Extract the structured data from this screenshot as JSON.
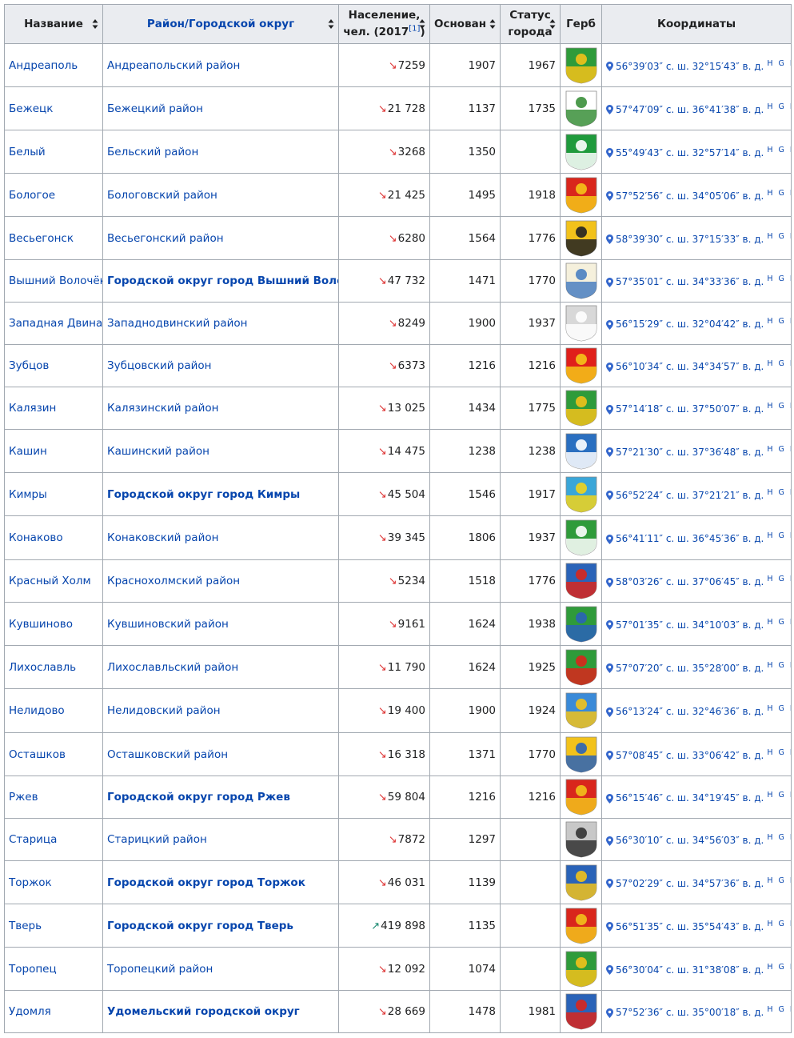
{
  "headers": {
    "name": "Название",
    "district": "Район/Городской округ",
    "population_line1": "Население,",
    "population_line2": "чел. (2017",
    "population_ref": "[1]",
    "population_close": ")",
    "founded": "Основан",
    "status_line1": "Статус",
    "status_line2": "города",
    "coat": "Герб",
    "coords": "Координаты"
  },
  "geo_links": "H G R O",
  "colors": {
    "link": "#0645ad",
    "header_bg": "#eaecf0",
    "border": "#a2a9b1",
    "down": "#dd3333",
    "up": "#14866d"
  },
  "rows": [
    {
      "name": "Андреаполь",
      "district": "Андреапольский район",
      "bold": false,
      "trend": "down",
      "population": "7259",
      "founded": "1907",
      "status": "1967",
      "coords": "56°39′03″ с. ш. 32°15′43″ в. д.",
      "coat_icon": "andreapol-coat-icon",
      "coat_colors": [
        "#2e9b3a",
        "#f3c21a"
      ]
    },
    {
      "name": "Бежецк",
      "district": "Бежецкий район",
      "bold": false,
      "trend": "down",
      "population": "21 728",
      "founded": "1137",
      "status": "1735",
      "coords": "57°47′09″ с. ш. 36°41′38″ в. д.",
      "coat_icon": "bezhetsk-coat-icon",
      "coat_colors": [
        "#ffffff",
        "#3a8f3a"
      ]
    },
    {
      "name": "Белый",
      "district": "Бельский район",
      "bold": false,
      "trend": "down",
      "population": "3268",
      "founded": "1350",
      "status": "",
      "coords": "55°49′43″ с. ш. 32°57′14″ в. д.",
      "coat_icon": "bely-coat-icon",
      "coat_colors": [
        "#1f9a3c",
        "#ffffff"
      ]
    },
    {
      "name": "Бологое",
      "district": "Бологовский район",
      "bold": false,
      "trend": "down",
      "population": "21 425",
      "founded": "1495",
      "status": "1918",
      "coords": "57°52′56″ с. ш. 34°05′06″ в. д.",
      "coat_icon": "bologoe-coat-icon",
      "coat_colors": [
        "#d9261c",
        "#f5c518"
      ]
    },
    {
      "name": "Весьегонск",
      "district": "Весьегонский район",
      "bold": false,
      "trend": "down",
      "population": "6280",
      "founded": "1564",
      "status": "1776",
      "coords": "58°39′30″ с. ш. 37°15′33″ в. д.",
      "coat_icon": "vesyegonsk-coat-icon",
      "coat_colors": [
        "#f2c21b",
        "#222222"
      ]
    },
    {
      "name": "Вышний Волочёк",
      "district": "Городской округ город Вышний Волочёк",
      "bold": true,
      "trend": "down",
      "population": "47 732",
      "founded": "1471",
      "status": "1770",
      "coords": "57°35′01″ с. ш. 34°33′36″ в. д.",
      "coat_icon": "vyshny-volochyok-coat-icon",
      "coat_colors": [
        "#f5f0dc",
        "#4a7fc1"
      ]
    },
    {
      "name": "Западная Двина",
      "district": "Западнодвинский район",
      "bold": false,
      "trend": "down",
      "population": "8249",
      "founded": "1900",
      "status": "1937",
      "coords": "56°15′29″ с. ш. 32°04′42″ в. д.",
      "coat_icon": "question-mark-coat-icon",
      "coat_colors": [
        "#d8d8d8",
        "#ffffff"
      ]
    },
    {
      "name": "Зубцов",
      "district": "Зубцовский район",
      "bold": false,
      "trend": "down",
      "population": "6373",
      "founded": "1216",
      "status": "1216",
      "coords": "56°10′34″ с. ш. 34°34′57″ в. д.",
      "coat_icon": "zubtsov-coat-icon",
      "coat_colors": [
        "#e0201b",
        "#f5c518"
      ]
    },
    {
      "name": "Калязин",
      "district": "Калязинский район",
      "bold": false,
      "trend": "down",
      "population": "13 025",
      "founded": "1434",
      "status": "1775",
      "coords": "57°14′18″ с. ш. 37°50′07″ в. д.",
      "coat_icon": "kalyazin-coat-icon",
      "coat_colors": [
        "#2f9b3a",
        "#f2c21b"
      ]
    },
    {
      "name": "Кашин",
      "district": "Кашинский район",
      "bold": false,
      "trend": "down",
      "population": "14 475",
      "founded": "1238",
      "status": "1238",
      "coords": "57°21′30″ с. ш. 37°36′48″ в. д.",
      "coat_icon": "kashin-coat-icon",
      "coat_colors": [
        "#2a6fc0",
        "#ffffff"
      ]
    },
    {
      "name": "Кимры",
      "district": "Городской округ город Кимры",
      "bold": true,
      "trend": "down",
      "population": "45 504",
      "founded": "1546",
      "status": "1917",
      "coords": "56°52′24″ с. ш. 37°21′21″ в. д.",
      "coat_icon": "kimry-coat-icon",
      "coat_colors": [
        "#3aa6d8",
        "#f2d41b"
      ]
    },
    {
      "name": "Конаково",
      "district": "Конаковский район",
      "bold": false,
      "trend": "down",
      "population": "39 345",
      "founded": "1806",
      "status": "1937",
      "coords": "56°41′11″ с. ш. 36°45′36″ в. д.",
      "coat_icon": "konakovo-coat-icon",
      "coat_colors": [
        "#2f9b3a",
        "#ffffff"
      ]
    },
    {
      "name": "Красный Холм",
      "district": "Краснохолмский район",
      "bold": false,
      "trend": "down",
      "population": "5234",
      "founded": "1518",
      "status": "1776",
      "coords": "58°03′26″ с. ш. 37°06′45″ в. д.",
      "coat_icon": "krasny-kholm-coat-icon",
      "coat_colors": [
        "#2a63b8",
        "#d9261c"
      ]
    },
    {
      "name": "Кувшиново",
      "district": "Кувшиновский район",
      "bold": false,
      "trend": "down",
      "population": "9161",
      "founded": "1624",
      "status": "1938",
      "coords": "57°01′35″ с. ш. 34°10′03″ в. д.",
      "coat_icon": "kuvshinovo-coat-icon",
      "coat_colors": [
        "#2f9b3a",
        "#2a63b8"
      ]
    },
    {
      "name": "Лихославль",
      "district": "Лихославльский район",
      "bold": false,
      "trend": "down",
      "population": "11 790",
      "founded": "1624",
      "status": "1925",
      "coords": "57°07′20″ с. ш. 35°28′00″ в. д.",
      "coat_icon": "likhoslavl-coat-icon",
      "coat_colors": [
        "#2f9b3a",
        "#d9261c"
      ]
    },
    {
      "name": "Нелидово",
      "district": "Нелидовский район",
      "bold": false,
      "trend": "down",
      "population": "19 400",
      "founded": "1900",
      "status": "1924",
      "coords": "56°13′24″ с. ш. 32°46′36″ в. д.",
      "coat_icon": "nelidovo-coat-icon",
      "coat_colors": [
        "#3a8ad8",
        "#f2c21b"
      ]
    },
    {
      "name": "Осташков",
      "district": "Осташковский район",
      "bold": false,
      "trend": "down",
      "population": "16 318",
      "founded": "1371",
      "status": "1770",
      "coords": "57°08′45″ с. ш. 33°06′42″ в. д.",
      "coat_icon": "ostashkov-coat-icon",
      "coat_colors": [
        "#f2c21b",
        "#2a63b8"
      ]
    },
    {
      "name": "Ржев",
      "district": "Городской округ город Ржев",
      "bold": true,
      "trend": "down",
      "population": "59 804",
      "founded": "1216",
      "status": "1216",
      "coords": "56°15′46″ с. ш. 34°19′45″ в. д.",
      "coat_icon": "rzhev-coat-icon",
      "coat_colors": [
        "#d9261c",
        "#f2c21b"
      ]
    },
    {
      "name": "Старица",
      "district": "Старицкий район",
      "bold": false,
      "trend": "down",
      "population": "7872",
      "founded": "1297",
      "status": "",
      "coords": "56°30′10″ с. ш. 34°56′03″ в. д.",
      "coat_icon": "staritsa-coat-icon",
      "coat_colors": [
        "#c8c8c8",
        "#333333"
      ]
    },
    {
      "name": "Торжок",
      "district": "Городской округ город Торжок",
      "bold": true,
      "trend": "down",
      "population": "46 031",
      "founded": "1139",
      "status": "",
      "coords": "57°02′29″ с. ш. 34°57′36″ в. д.",
      "coat_icon": "torzhok-coat-icon",
      "coat_colors": [
        "#2a63b8",
        "#f2c21b"
      ]
    },
    {
      "name": "Тверь",
      "district": "Городской округ город Тверь",
      "bold": true,
      "trend": "up",
      "population": "419 898",
      "founded": "1135",
      "status": "",
      "coords": "56°51′35″ с. ш. 35°54′43″ в. д.",
      "coat_icon": "tver-coat-icon",
      "coat_colors": [
        "#d9261c",
        "#f2c21b"
      ]
    },
    {
      "name": "Торопец",
      "district": "Торопецкий район",
      "bold": false,
      "trend": "down",
      "population": "12 092",
      "founded": "1074",
      "status": "",
      "coords": "56°30′04″ с. ш. 31°38′08″ в. д.",
      "coat_icon": "toropets-coat-icon",
      "coat_colors": [
        "#2f9b3a",
        "#f2c21b"
      ]
    },
    {
      "name": "Удомля",
      "district": "Удомельский городской округ",
      "bold": true,
      "trend": "down",
      "population": "28 669",
      "founded": "1478",
      "status": "1981",
      "coords": "57°52′36″ с. ш. 35°00′18″ в. д.",
      "coat_icon": "udomlya-coat-icon",
      "coat_colors": [
        "#2a63b8",
        "#d9261c"
      ]
    }
  ]
}
